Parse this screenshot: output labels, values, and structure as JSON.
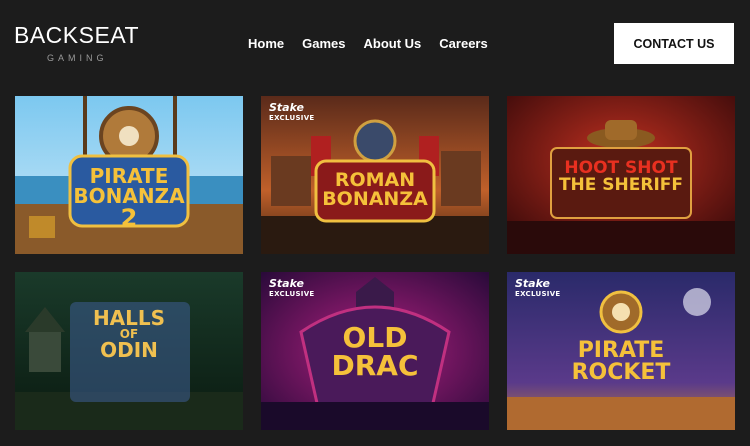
{
  "brand": {
    "name": "BACKSEAT",
    "tagline": "GAMING"
  },
  "nav": [
    {
      "label": "Home"
    },
    {
      "label": "Games"
    },
    {
      "label": "About Us"
    },
    {
      "label": "Careers"
    }
  ],
  "contact_label": "CONTACT US",
  "games": [
    {
      "title_lines": [
        "PIRATE",
        "BONANZA",
        "2"
      ],
      "badge": null
    },
    {
      "title_lines": [
        "ROMAN",
        "BONANZA"
      ],
      "badge": {
        "brand": "Stake",
        "text": "EXCLUSIVE"
      }
    },
    {
      "title_lines": [
        "HOOT SHOT",
        "THE SHERIFF"
      ],
      "badge": null
    },
    {
      "title_lines": [
        "HALLS",
        "OF",
        "ODIN"
      ],
      "badge": null
    },
    {
      "title_lines": [
        "OLD",
        "DRAC"
      ],
      "badge": {
        "brand": "Stake",
        "text": "EXCLUSIVE"
      }
    },
    {
      "title_lines": [
        "PIRATE",
        "ROCKET"
      ],
      "badge": {
        "brand": "Stake",
        "text": "EXCLUSIVE"
      }
    }
  ],
  "colors": {
    "background": "#1c1c1c",
    "contact_bg": "#ffffff",
    "title_gold": "#f5c13a"
  }
}
